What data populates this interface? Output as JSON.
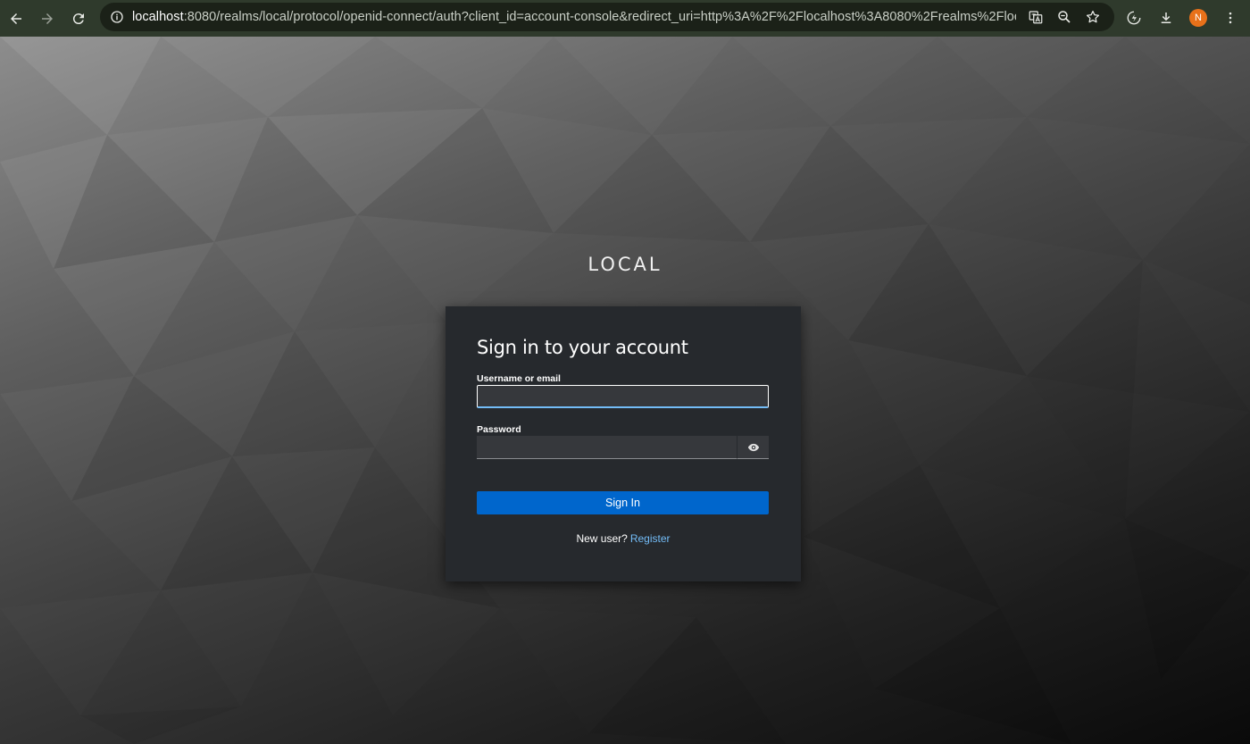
{
  "browser": {
    "url_host": "localhost",
    "url_rest": ":8080/realms/local/protocol/openid-connect/auth?client_id=account-console&redirect_uri=http%3A%2F%2Flocalhost%3A8080%2Frealms%2Flocal%2Facc...",
    "profile_initial": "N",
    "icons": [
      "back-arrow-icon",
      "forward-arrow-icon",
      "reload-icon",
      "site-info-icon",
      "translate-icon",
      "zoom-icon",
      "bookmark-star-icon",
      "extension-icon",
      "download-icon",
      "kebab-menu-icon"
    ]
  },
  "realm": {
    "name": "LOCAL"
  },
  "login": {
    "title": "Sign in to your account",
    "username_label": "Username or email",
    "username_value": "",
    "password_label": "Password",
    "password_value": "",
    "signin_label": "Sign In",
    "new_user_text": "New user?",
    "register_label": "Register"
  },
  "colors": {
    "accent": "#0066cc",
    "link": "#73bcf7",
    "card_bg": "#26292d",
    "toolbar_bg": "#2f3a2c"
  }
}
